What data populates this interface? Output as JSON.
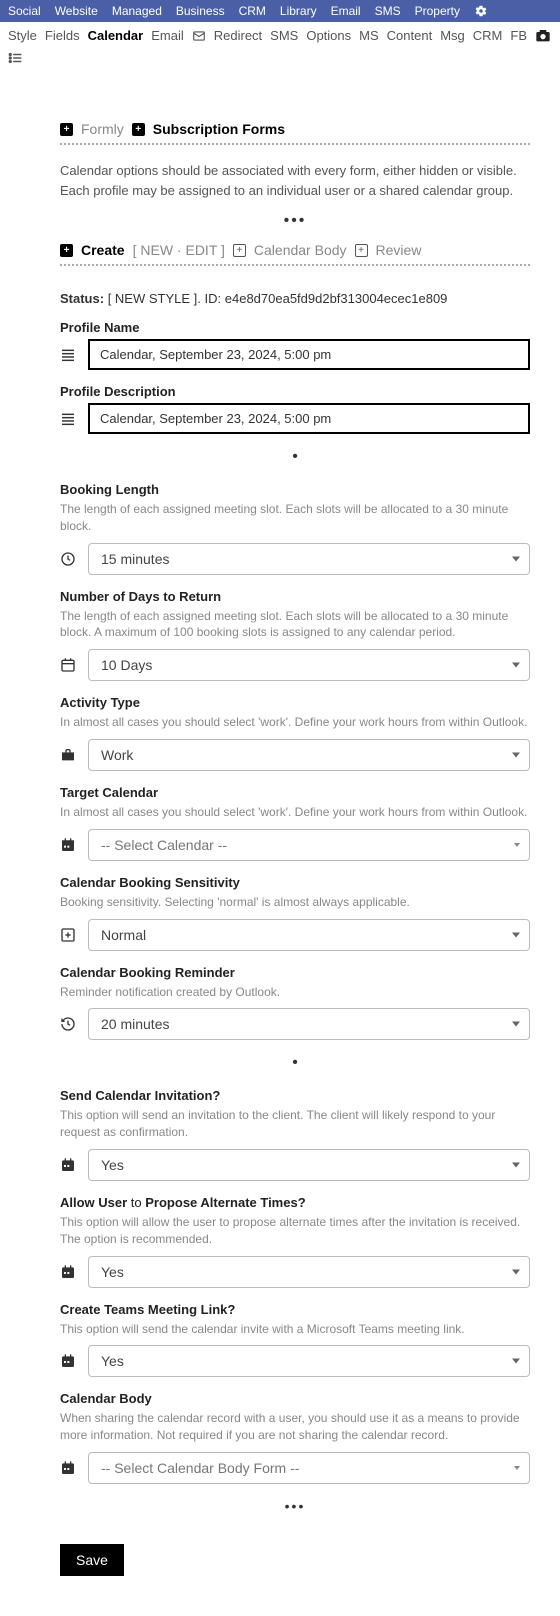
{
  "topnav": [
    "Social",
    "Website",
    "Managed",
    "Business",
    "CRM",
    "Library",
    "Email",
    "SMS",
    "Property"
  ],
  "subnav": [
    "Style",
    "Fields",
    "Calendar",
    "Email",
    "Redirect",
    "SMS",
    "Options",
    "MS",
    "Content",
    "Msg",
    "CRM",
    "FB"
  ],
  "subnav_active": "Calendar",
  "breadcrumb": {
    "a": "Formly",
    "b": "Subscription Forms"
  },
  "intro": "Calendar options should be associated with every form, either hidden or visible. Each profile may be assigned to an individual user or a shared calendar group.",
  "create_row": {
    "create": "Create",
    "newedit": "[ NEW · EDIT ]",
    "body": "Calendar Body",
    "review": "Review"
  },
  "status": {
    "label": "Status:",
    "tag": "[ NEW STYLE ].",
    "idlabel": "ID:",
    "id": "e4e8d70ea5fd9d2bf313004ecec1e809"
  },
  "fields": {
    "profile_name": {
      "label": "Profile Name",
      "value": "Calendar, September 23, 2024, 5:00 pm"
    },
    "profile_desc": {
      "label": "Profile Description",
      "value": "Calendar, September 23, 2024, 5:00 pm"
    },
    "booking_length": {
      "label": "Booking Length",
      "help": "The length of each assigned meeting slot. Each slots will be allocated to a 30 minute block.",
      "value": "15 minutes"
    },
    "days_return": {
      "label": "Number of Days to Return",
      "help": "The length of each assigned meeting slot. Each slots will be allocated to a 30 minute block. A maximum of 100 booking slots is assigned to any calendar period.",
      "value": "10 Days"
    },
    "activity_type": {
      "label": "Activity Type",
      "help": "In almost all cases you should select 'work'. Define your work hours from within Outlook.",
      "value": "Work"
    },
    "target_calendar": {
      "label": "Target Calendar",
      "help": "In almost all cases you should select 'work'. Define your work hours from within Outlook.",
      "value": "-- Select Calendar --"
    },
    "sensitivity": {
      "label": "Calendar Booking Sensitivity",
      "help": "Booking sensitivity. Selecting 'normal' is almost always applicable.",
      "value": "Normal"
    },
    "reminder": {
      "label": "Calendar Booking Reminder",
      "help": "Reminder notification created by Outlook.",
      "value": "20 minutes"
    },
    "send_invite": {
      "label": "Send Calendar Invitation?",
      "help": "This option will send an invitation to the client. The client will likely respond to your request as confirmation.",
      "value": "Yes"
    },
    "allow_alt": {
      "label_a": "Allow User",
      "label_b": " to ",
      "label_c": "Propose Alternate Times?",
      "help": "This option will allow the user to propose alternate times after the invitation is received. The option is recommended.",
      "value": "Yes"
    },
    "teams_link": {
      "label": "Create Teams Meeting Link?",
      "help": "This option will send the calendar invite with a Microsoft Teams meeting link.",
      "value": "Yes"
    },
    "cal_body": {
      "label": "Calendar Body",
      "help": "When sharing the calendar record with a user, you should use it as a means to provide more information. Not required if you are not sharing the calendar record.",
      "value": "-- Select Calendar Body Form --"
    }
  },
  "save": "Save"
}
